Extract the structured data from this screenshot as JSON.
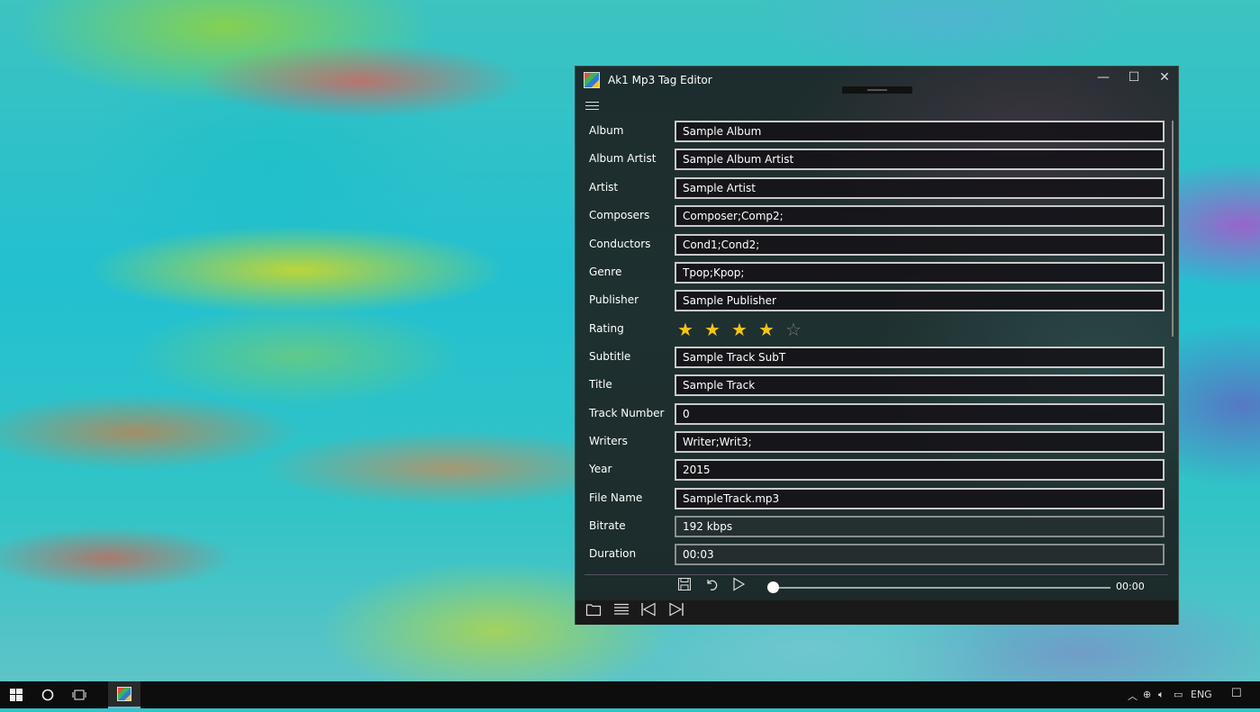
{
  "app": {
    "title": "Ak1 Mp3 Tag Editor",
    "minimize_glyph": "—",
    "maximize_glyph": "☐",
    "close_glyph": "✕"
  },
  "fields": {
    "album": {
      "label": "Album",
      "value": "Sample Album"
    },
    "album_artist": {
      "label": "Album Artist",
      "value": "Sample Album Artist"
    },
    "artist": {
      "label": "Artist",
      "value": "Sample Artist"
    },
    "composers": {
      "label": "Composers",
      "value": "Composer;Comp2;"
    },
    "conductors": {
      "label": "Conductors",
      "value": "Cond1;Cond2;"
    },
    "genre": {
      "label": "Genre",
      "value": "Tpop;Kpop;"
    },
    "publisher": {
      "label": "Publisher",
      "value": "Sample Publisher"
    },
    "rating": {
      "label": "Rating",
      "value": 4,
      "max": 5,
      "star_glyph": "★",
      "empty_star_glyph": "☆",
      "star_color": "#f2c519"
    },
    "subtitle": {
      "label": "Subtitle",
      "value": "Sample Track SubT"
    },
    "title": {
      "label": "Title",
      "value": "Sample Track"
    },
    "track_number": {
      "label": "Track Number",
      "value": "0"
    },
    "writers": {
      "label": "Writers",
      "value": "Writer;Writ3;"
    },
    "year": {
      "label": "Year",
      "value": "2015"
    },
    "file_name": {
      "label": "File Name",
      "value": "SampleTrack.mp3"
    },
    "bitrate": {
      "label": "Bitrate",
      "value": "192 kbps"
    },
    "duration": {
      "label": "Duration",
      "value": "00:03"
    }
  },
  "player": {
    "time": "00:00",
    "position": 0,
    "icons": [
      "save-icon",
      "undo-icon",
      "play-icon"
    ]
  },
  "bottom_toolbar": {
    "icons": [
      "folder-icon",
      "list-icon",
      "previous-track-icon",
      "next-track-icon"
    ]
  },
  "taskbar": {
    "language": "ENG",
    "accent": "#6ab7e8"
  }
}
